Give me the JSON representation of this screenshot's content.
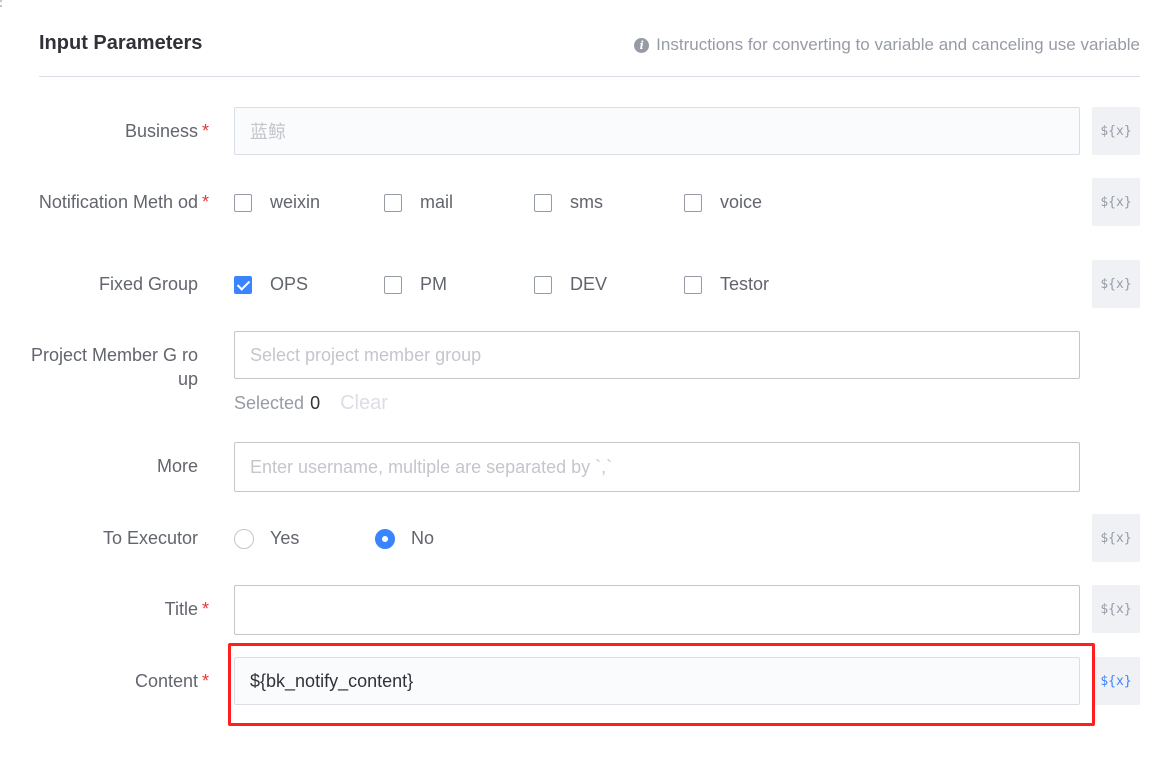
{
  "header": {
    "title": "Input Parameters",
    "hint": "Instructions for converting to variable and canceling use variable",
    "hint_icon": "info-icon"
  },
  "var_button_label": "${x}",
  "required_mark": "*",
  "fields": {
    "business": {
      "label": "Business",
      "value": "蓝鲸"
    },
    "notification_method": {
      "label": "Notification Meth od",
      "options": [
        {
          "label": "weixin",
          "checked": false
        },
        {
          "label": "mail",
          "checked": false
        },
        {
          "label": "sms",
          "checked": false
        },
        {
          "label": "voice",
          "checked": false
        }
      ]
    },
    "fixed_group": {
      "label": "Fixed Group",
      "options": [
        {
          "label": "OPS",
          "checked": true
        },
        {
          "label": "PM",
          "checked": false
        },
        {
          "label": "DEV",
          "checked": false
        },
        {
          "label": "Testor",
          "checked": false
        }
      ]
    },
    "project_member_group": {
      "label": "Project Member G roup",
      "placeholder": "Select project member group",
      "selected_label": "Selected",
      "selected_count": "0",
      "clear_label": "Clear"
    },
    "more": {
      "label": "More",
      "placeholder": "Enter username, multiple are separated by `,`"
    },
    "to_executor": {
      "label": "To Executor",
      "options": [
        {
          "label": "Yes",
          "checked": false
        },
        {
          "label": "No",
          "checked": true
        }
      ]
    },
    "title": {
      "label": "Title",
      "value": ""
    },
    "content": {
      "label": "Content",
      "value": "${bk_notify_content}"
    }
  },
  "colors": {
    "accent": "#3a84ff",
    "required": "#ea3636",
    "highlight": "#ff1f1f"
  }
}
